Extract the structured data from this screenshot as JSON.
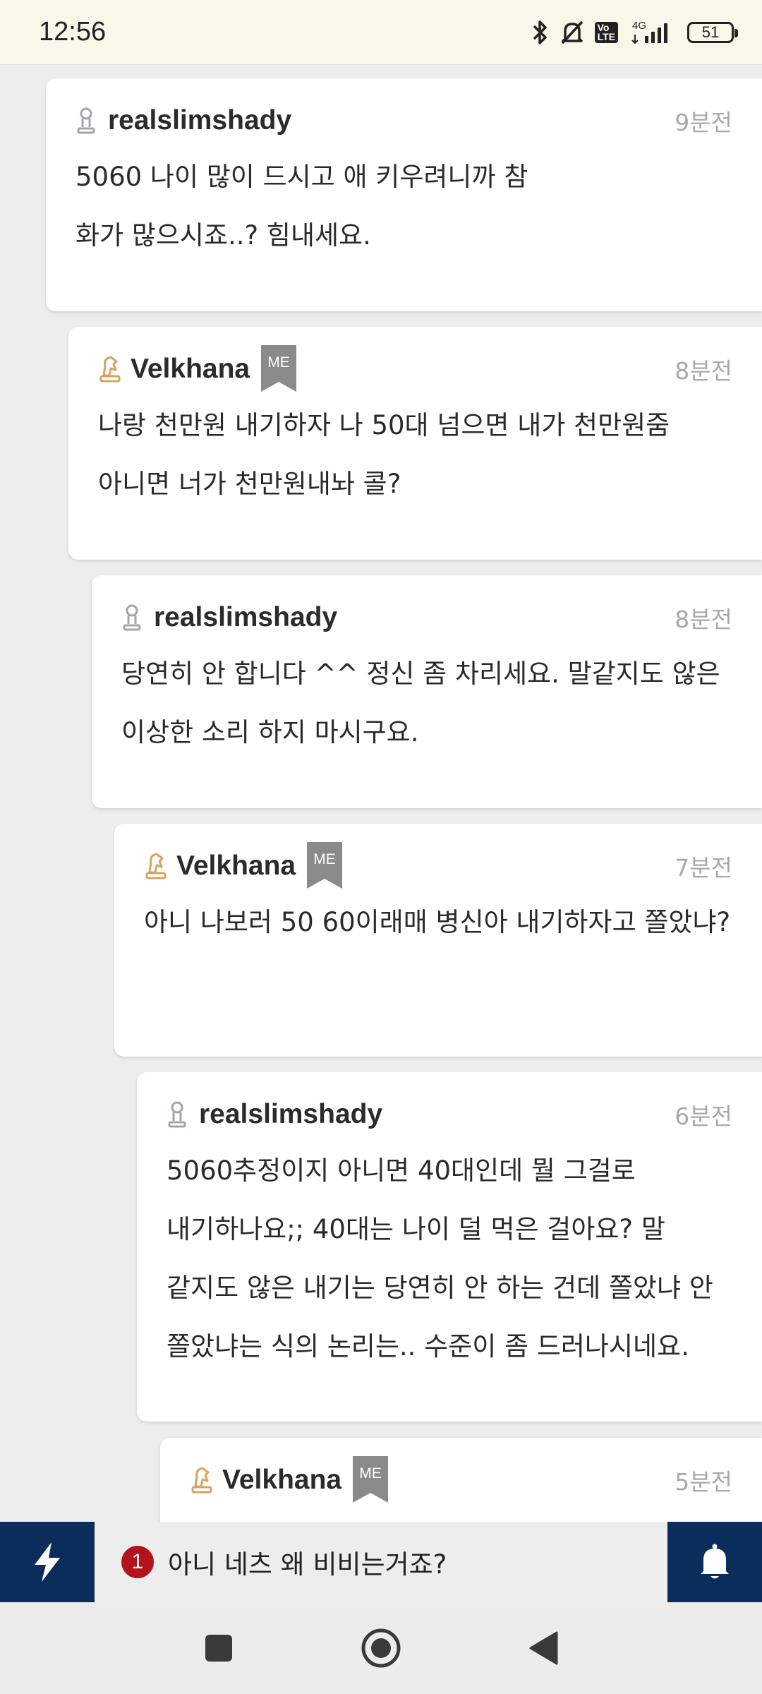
{
  "status_bar": {
    "time": "12:56",
    "lte_label": "VoLTE",
    "network": "4G",
    "battery": "51",
    "icons": [
      "bluetooth-icon",
      "mute-icon",
      "volte-icon",
      "signal-icon",
      "battery-icon"
    ]
  },
  "comments": [
    {
      "author": "realslimshady",
      "time": "9분전",
      "is_me": false,
      "text": "5060 나이 많이 드시고 애 키우려니까 참 화가 많으시죠..? 힘내세요."
    },
    {
      "author": "Velkhana",
      "time": "8분전",
      "is_me": true,
      "badge": "ME",
      "text": "나랑 천만원 내기하자 나 50대 넘으면 내가 천만원줌 아니면 너가 천만원내놔 콜?"
    },
    {
      "author": "realslimshady",
      "time": "8분전",
      "is_me": false,
      "text": "당연히 안 합니다 ^^ 정신 좀 차리세요. 말같지도 않은 이상한 소리 하지 마시구요."
    },
    {
      "author": "Velkhana",
      "time": "7분전",
      "is_me": true,
      "badge": "ME",
      "text": "아니 나보러 50 60이래매 병신아 내기하자고 쫄았냐?"
    },
    {
      "author": "realslimshady",
      "time": "6분전",
      "is_me": false,
      "text": "5060추정이지 아니면 40대인데 뭘 그걸로 내기하나요;; 40대는 나이 덜 먹은 걸아요? 말 같지도 않은 내기는 당연히 안 하는 건데 쫄았냐 안 쫄았냐는 식의 논리는.. 수준이 좀 드러나시네요."
    },
    {
      "author": "Velkhana",
      "time": "5분전",
      "is_me": true,
      "badge": "ME",
      "text": ""
    }
  ],
  "action_bar": {
    "notice_count": "1",
    "notice_text": "아니 네츠 왜 비비는거죠?"
  },
  "colors": {
    "navy": "#0b2d5c",
    "badge_red": "#b3141c",
    "me_badge": "#8a8a8a",
    "gold_icon": "#d6a462",
    "gray_icon": "#a0a4ad"
  }
}
